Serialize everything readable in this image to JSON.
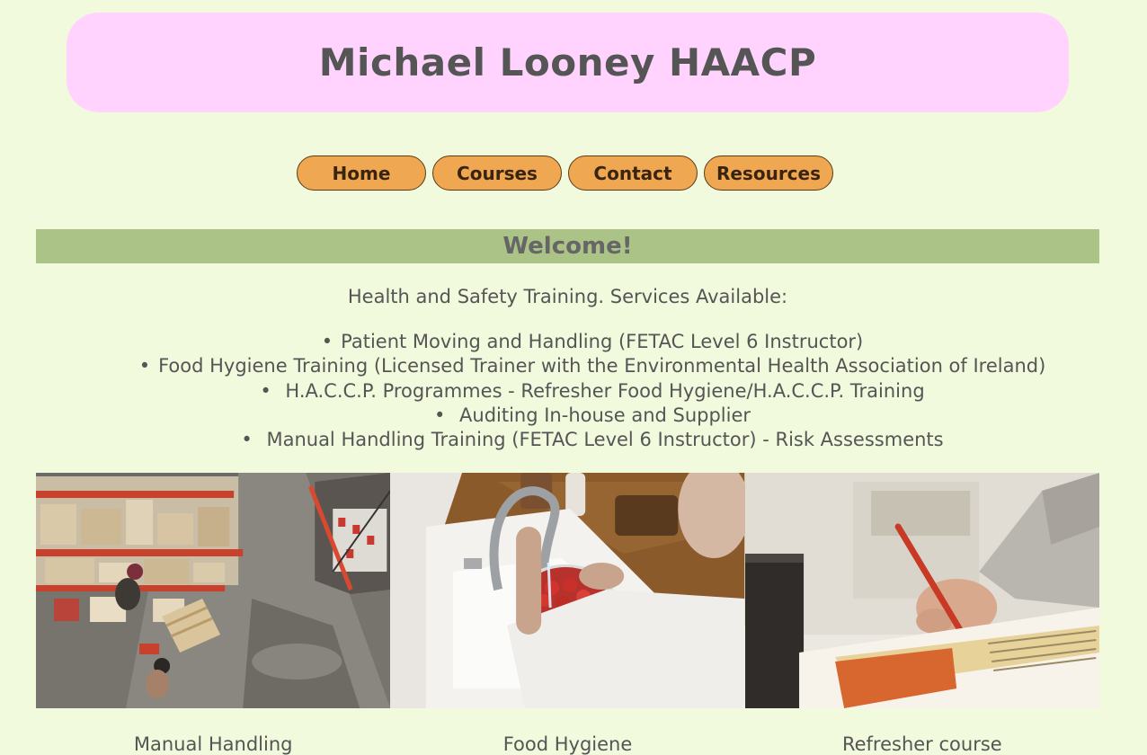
{
  "header": {
    "title": "Michael Looney HAACP"
  },
  "nav": {
    "items": [
      "Home",
      "Courses",
      "Contact",
      "Resources"
    ]
  },
  "welcome": {
    "heading": "Welcome!"
  },
  "intro": {
    "text": "Health and Safety Training. Services Available:"
  },
  "services": [
    "Patient Moving and Handling (FETAC Level 6 Instructor)",
    "Food Hygiene Training (Licensed Trainer with the Environmental Health Association of Ireland)",
    " H.A.C.C.P. Programmes - Refresher Food Hygiene/H.A.C.C.P. Training",
    " Auditing In-house and Supplier",
    " Manual Handling Training (FETAC Level 6 Instructor) - Risk Assessments"
  ],
  "gallery": [
    {
      "caption": "Manual Handling",
      "image": "warehouse-photo"
    },
    {
      "caption": "Food Hygiene",
      "image": "washing-strawberries-photo"
    },
    {
      "caption": "Refresher course",
      "image": "writing-notebook-photo"
    }
  ],
  "colors": {
    "background": "#f1fadd",
    "header_bg": "#ffd3fd",
    "nav_button": "#efa851",
    "welcome_bar": "#abc387",
    "text": "#555555"
  }
}
